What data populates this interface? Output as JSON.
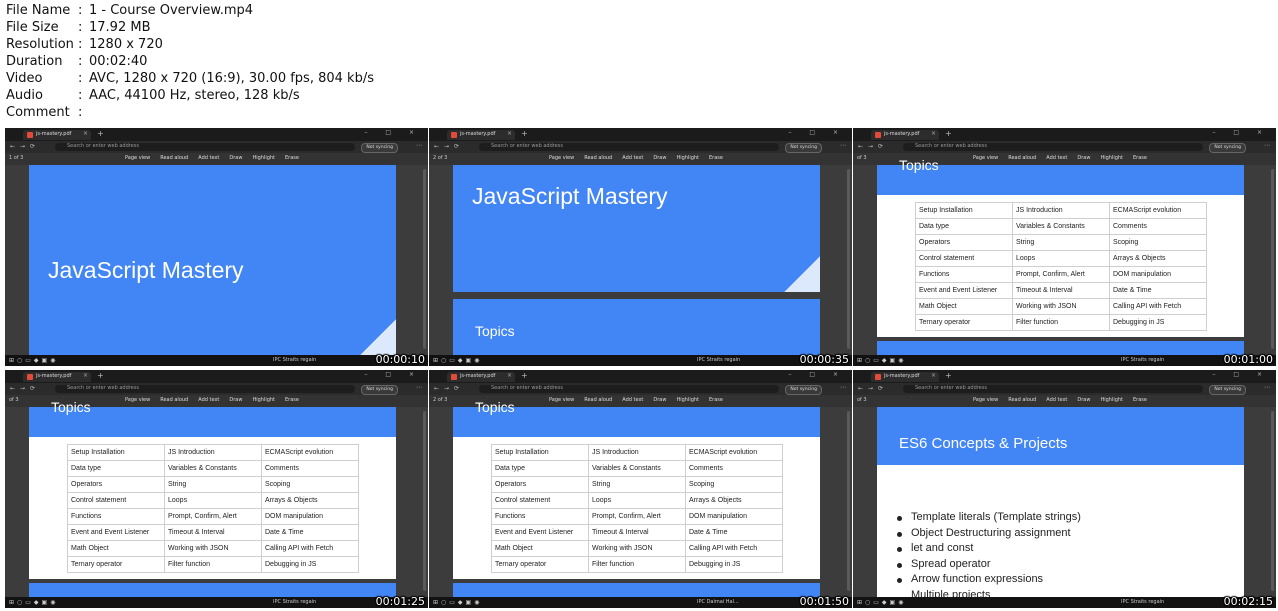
{
  "meta": [
    {
      "key": "File Name",
      "value": "1 - Course Overview.mp4"
    },
    {
      "key": "File Size",
      "value": "17.92 MB"
    },
    {
      "key": "Resolution",
      "value": "1280 x 720"
    },
    {
      "key": "Duration",
      "value": "00:02:40"
    },
    {
      "key": "Video",
      "value": "AVC, 1280 x 720 (16:9), 30.00 fps, 804 kb/s"
    },
    {
      "key": "Audio",
      "value": "AAC, 44100 Hz, stereo, 128 kb/s"
    },
    {
      "key": "Comment",
      "value": ""
    }
  ],
  "separator": ":",
  "browser": {
    "tab_title": "js-mastery.pdf",
    "address_placeholder": "Search or enter web address",
    "sync_label": "Not syncing",
    "page_indicators": [
      "1 of 3",
      "2 of 3",
      "of 3",
      "of 3",
      "2 of 3",
      "of 3"
    ],
    "tools": [
      "Page view",
      "Read aloud",
      "Add text",
      "Draw",
      "Highlight",
      "Erase"
    ],
    "weather": "IPC Straits regain",
    "weather_alt": "IPC Daimai Hal..."
  },
  "slides": {
    "title": "JavaScript Mastery",
    "topics_heading": "Topics",
    "es6_heading": "ES6 Concepts & Projects",
    "topics_table": [
      [
        "Setup Installation",
        "JS Introduction",
        "ECMAScript evolution"
      ],
      [
        "Data type",
        "Variables & Constants",
        "Comments"
      ],
      [
        "Operators",
        "String",
        "Scoping"
      ],
      [
        "Control statement",
        "Loops",
        "Arrays & Objects"
      ],
      [
        "Functions",
        "Prompt, Confirm, Alert",
        "DOM manipulation"
      ],
      [
        "Event and Event Listener",
        "Timeout & Interval",
        "Date & Time"
      ],
      [
        "Math Object",
        "Working with JSON",
        "Calling API with Fetch"
      ],
      [
        "Ternary operator",
        "Filter function",
        "Debugging in JS"
      ]
    ],
    "es6_list": [
      {
        "text": "Template literals (Template strings)",
        "bullet": true
      },
      {
        "text": "Object Destructuring assignment",
        "bullet": true
      },
      {
        "text": "let and const",
        "bullet": true
      },
      {
        "text": "Spread operator",
        "bullet": true
      },
      {
        "text": "Arrow function expressions",
        "bullet": true
      },
      {
        "text": "Multiple projects",
        "bullet": false
      }
    ]
  },
  "thumbnails": [
    {
      "timestamp": "00:00:10"
    },
    {
      "timestamp": "00:00:35"
    },
    {
      "timestamp": "00:01:00"
    },
    {
      "timestamp": "00:01:25"
    },
    {
      "timestamp": "00:01:50"
    },
    {
      "timestamp": "00:02:15"
    }
  ]
}
